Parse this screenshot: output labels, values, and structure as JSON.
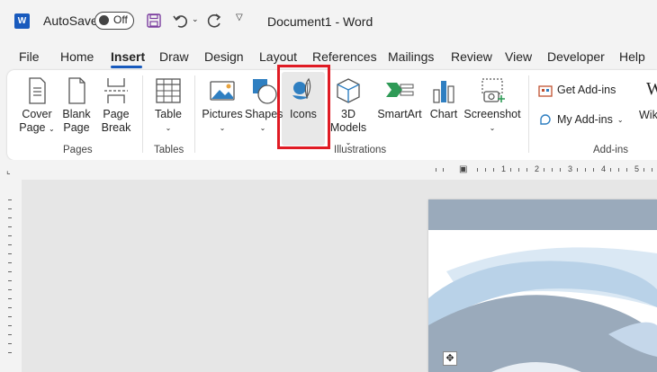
{
  "titlebar": {
    "autosave_label": "AutoSave",
    "autosave_state": "Off",
    "document_title": "Document1  -  Word"
  },
  "tabs": [
    {
      "label": "File"
    },
    {
      "label": "Home"
    },
    {
      "label": "Insert",
      "active": true
    },
    {
      "label": "Draw"
    },
    {
      "label": "Design"
    },
    {
      "label": "Layout"
    },
    {
      "label": "References"
    },
    {
      "label": "Mailings"
    },
    {
      "label": "Review"
    },
    {
      "label": "View"
    },
    {
      "label": "Developer"
    },
    {
      "label": "Help"
    }
  ],
  "ribbon": {
    "pages": {
      "group_label": "Pages",
      "cover_page": [
        "Cover",
        "Page"
      ],
      "blank_page": [
        "Blank",
        "Page"
      ],
      "page_break": [
        "Page",
        "Break"
      ]
    },
    "tables": {
      "group_label": "Tables",
      "table": "Table"
    },
    "illustrations": {
      "group_label": "Illustrations",
      "pictures": "Pictures",
      "shapes": "Shapes",
      "icons": "Icons",
      "models": [
        "3D",
        "Models"
      ],
      "smartart": "SmartArt",
      "chart": "Chart",
      "screenshot": "Screenshot"
    },
    "addins": {
      "group_label": "Add-ins",
      "get_addins": "Get Add-ins",
      "my_addins": "My Add-ins",
      "wiki": "Wiki"
    }
  },
  "ruler": {
    "numbers": [
      "1",
      "2",
      "3",
      "4",
      "5"
    ]
  },
  "colors": {
    "accent": "#185abd",
    "highlight_box": "#e01b24",
    "page_header": "#9aaabb"
  }
}
